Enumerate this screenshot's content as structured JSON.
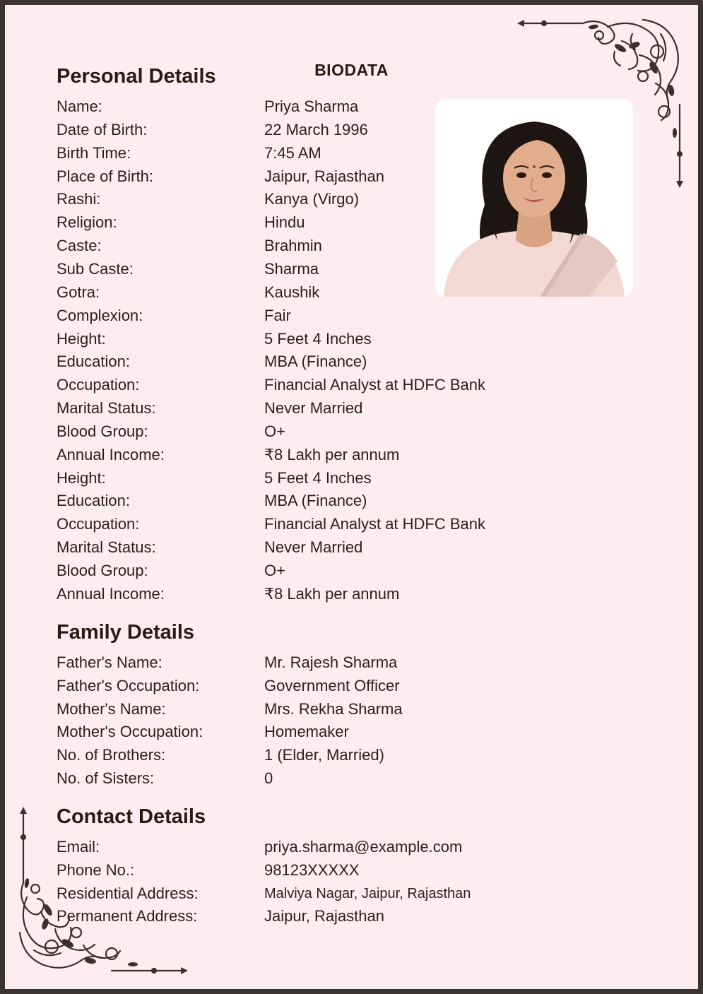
{
  "title": "BIODATA",
  "personal": {
    "heading": "Personal Details",
    "rows": [
      {
        "label": "Name:",
        "value": "Priya Sharma"
      },
      {
        "label": "Date of Birth:",
        "value": "22 March 1996"
      },
      {
        "label": "Birth Time:",
        "value": "7:45 AM"
      },
      {
        "label": "Place of Birth:",
        "value": "Jaipur, Rajasthan"
      },
      {
        "label": "Rashi:",
        "value": "Kanya (Virgo)"
      },
      {
        "label": "Religion:",
        "value": "Hindu"
      },
      {
        "label": "Caste:",
        "value": "Brahmin"
      },
      {
        "label": "Sub Caste:",
        "value": "Sharma"
      },
      {
        "label": "Gotra:",
        "value": "Kaushik"
      },
      {
        "label": "Complexion:",
        "value": "Fair"
      },
      {
        "label": "Height:",
        "value": "5 Feet 4 Inches"
      },
      {
        "label": "Education:",
        "value": "MBA (Finance)"
      },
      {
        "label": "Occupation:",
        "value": "Financial Analyst at HDFC Bank"
      },
      {
        "label": "Marital Status:",
        "value": "Never Married"
      },
      {
        "label": "Blood Group:",
        "value": "O+"
      },
      {
        "label": "Annual Income:",
        "value": "₹8 Lakh per annum"
      },
      {
        "label": "Height:",
        "value": "5 Feet 4 Inches"
      },
      {
        "label": "Education:",
        "value": "MBA (Finance)"
      },
      {
        "label": "Occupation:",
        "value": "Financial Analyst at HDFC Bank"
      },
      {
        "label": "Marital Status:",
        "value": "Never Married"
      },
      {
        "label": "Blood Group:",
        "value": "O+"
      },
      {
        "label": "Annual Income:",
        "value": "₹8 Lakh per annum"
      }
    ]
  },
  "family": {
    "heading": "Family Details",
    "rows": [
      {
        "label": "Father's Name:",
        "value": "Mr. Rajesh Sharma"
      },
      {
        "label": "Father's Occupation:",
        "value": "Government Officer"
      },
      {
        "label": "Mother's Name:",
        "value": "Mrs. Rekha Sharma"
      },
      {
        "label": "Mother's Occupation:",
        "value": "Homemaker"
      },
      {
        "label": "No. of Brothers:",
        "value": "1 (Elder, Married)"
      },
      {
        "label": "No. of Sisters:",
        "value": "0"
      }
    ]
  },
  "contact": {
    "heading": "Contact Details",
    "rows": [
      {
        "label": "Email:",
        "value": "priya.sharma@example.com"
      },
      {
        "label": "Phone No.:",
        "value": "98123XXXXX"
      },
      {
        "label": "Residential Address:",
        "value": "Malviya Nagar, Jaipur, Rajasthan"
      },
      {
        "label": "Permanent Address:",
        "value": "Jaipur, Rajasthan"
      }
    ]
  },
  "icons": {
    "profile_photo": "profile-photo",
    "corner_top_right": "floral-corner-ornament-icon",
    "corner_bottom_left": "floral-corner-ornament-icon"
  },
  "colors": {
    "page_background": "#fdedf1",
    "border": "#3a3530",
    "text": "#2a1a14"
  }
}
